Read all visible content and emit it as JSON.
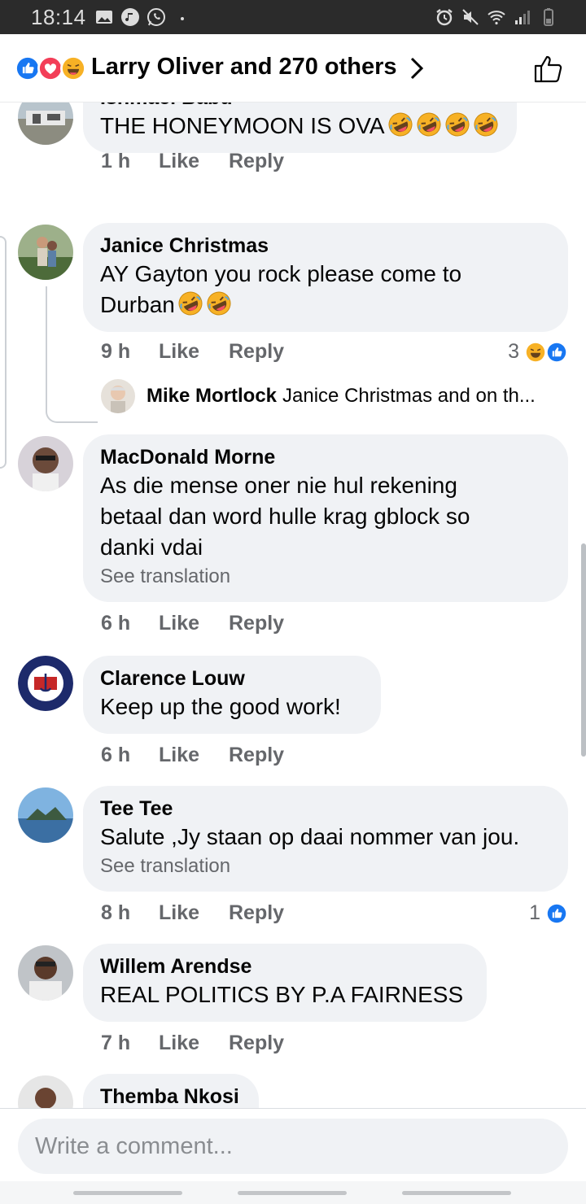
{
  "status_bar": {
    "time": "18:14",
    "left_icons": [
      "gallery-icon",
      "music-icon",
      "whatsapp-icon",
      "dot-icon"
    ],
    "right_icons": [
      "alarm-icon",
      "mute-icon",
      "wifi-icon",
      "signal-icon",
      "battery-icon"
    ]
  },
  "header": {
    "reactions_label": "Larry Oliver and 270 others",
    "reaction_icons": [
      "like-reaction-icon",
      "love-reaction-icon",
      "haha-reaction-icon"
    ]
  },
  "comments": [
    {
      "name": "Ishmael Babu",
      "text": "THE HONEYMOON IS OVA",
      "emoji": [
        "rofl",
        "rofl",
        "rofl",
        "rofl"
      ],
      "time": "1 h",
      "like": "Like",
      "reply": "Reply"
    },
    {
      "name": "Janice Christmas",
      "text_line1": "AY Gayton you rock please come to",
      "text_line2": "Durban",
      "emoji": [
        "rofl",
        "rofl"
      ],
      "time": "9 h",
      "like": "Like",
      "reply": "Reply",
      "reaction_count": "3",
      "reply_preview": {
        "name": "Mike Mortlock",
        "snippet": "Janice Christmas and on th..."
      }
    },
    {
      "name": "MacDonald Morne",
      "text_lines": [
        "As die mense oner nie hul rekening",
        "betaal dan word hulle krag gblock so",
        "danki vdai"
      ],
      "see_translation": "See translation",
      "time": "6 h",
      "like": "Like",
      "reply": "Reply"
    },
    {
      "name": "Clarence Louw",
      "text": "Keep up the good work!",
      "time": "6 h",
      "like": "Like",
      "reply": "Reply"
    },
    {
      "name": "Tee Tee",
      "text": "Salute ,Jy staan op daai nommer van jou.",
      "see_translation": "See translation",
      "time": "8 h",
      "like": "Like",
      "reply": "Reply",
      "reaction_count": "1"
    },
    {
      "name": "Willem Arendse",
      "text": "REAL POLITICS BY P.A FAIRNESS",
      "time": "7 h",
      "like": "Like",
      "reply": "Reply"
    },
    {
      "name": "Themba Nkosi"
    }
  ],
  "composer": {
    "placeholder": "Write a comment..."
  },
  "colors": {
    "bubble": "#f0f2f5",
    "meta_text": "#65676b",
    "like_blue": "#1877f2",
    "love_red": "#f33e58",
    "haha_yellow": "#f7b125"
  }
}
